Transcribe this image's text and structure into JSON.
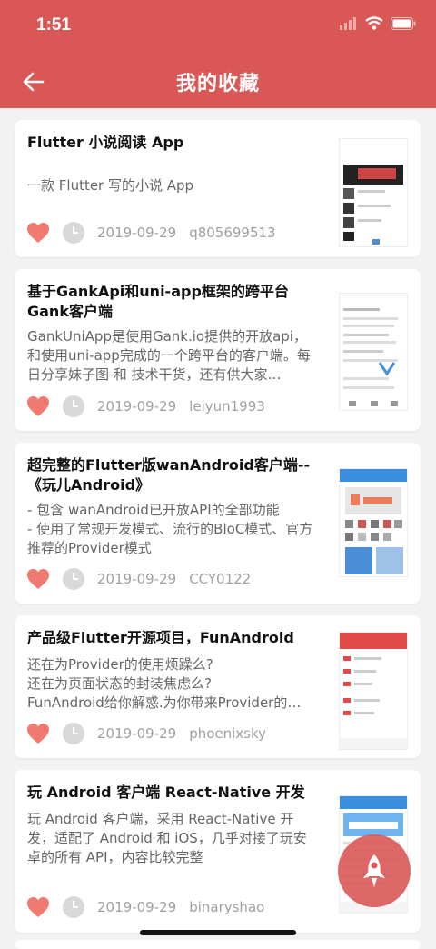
{
  "status": {
    "time": "1:51"
  },
  "header": {
    "title": "我的收藏"
  },
  "items": [
    {
      "title": "Flutter 小说阅读 App",
      "desc": "一款 Flutter 写的小说 App",
      "date": "2019-09-29",
      "author": "q805699513"
    },
    {
      "title": "基于GankApi和uni-app框架的跨平台Gank客户端",
      "desc": "GankUniApp是使用Gank.io提供的开放api，和使用uni-app完成的一个跨平台的客户端。每日分享妹子图 和 技术干货，还有供大家…",
      "date": "2019-09-29",
      "author": "leiyun1993"
    },
    {
      "title": "超完整的Flutter版wanAndroid客户端--《玩儿Android》",
      "desc": "- 包含 wanAndroid已开放API的全部功能\n- 使用了常规开发模式、流行的BloC模式、官方推荐的Provider模式",
      "date": "2019-09-29",
      "author": "CCY0122"
    },
    {
      "title": "产品级Flutter开源项目，FunAndroid",
      "desc": "还在为Provider的使用烦躁么?\n还在为页面状态的封装焦虑么?\nFunAndroid给你解惑.为你带来Provider的…",
      "date": "2019-09-29",
      "author": "phoenixsky"
    },
    {
      "title": "玩 Android 客户端 React-Native 开发",
      "desc": "玩 Android 客户端，采用 React-Native 开发，适配了 Android 和 iOS，几乎对接了玩安卓的所有 API，内容比较完整",
      "date": "2019-09-29",
      "author": "binaryshao"
    }
  ],
  "icons": {
    "back": "back-arrow-icon",
    "like": "heart-icon",
    "time": "clock-icon",
    "fab": "rocket-icon"
  },
  "colors": {
    "primary": "#d95856",
    "heart": "#f07a6f"
  }
}
